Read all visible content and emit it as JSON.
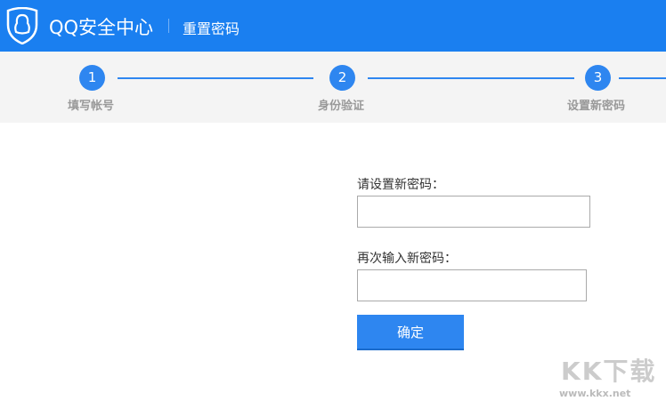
{
  "header": {
    "brand": "QQ安全中心",
    "subtitle": "重置密码"
  },
  "steps": [
    {
      "num": "1",
      "label": "填写帐号"
    },
    {
      "num": "2",
      "label": "身份验证"
    },
    {
      "num": "3",
      "label": "设置新密码"
    }
  ],
  "form": {
    "new_password_label": "请设置新密码：",
    "confirm_password_label": "再次输入新密码：",
    "new_password_value": "",
    "confirm_password_value": "",
    "submit_label": "确定"
  },
  "watermark": {
    "logo": "KK下载",
    "url": "www.kkx.net"
  },
  "colors": {
    "header": "#1a7ff0",
    "accent": "#2e86f0"
  }
}
